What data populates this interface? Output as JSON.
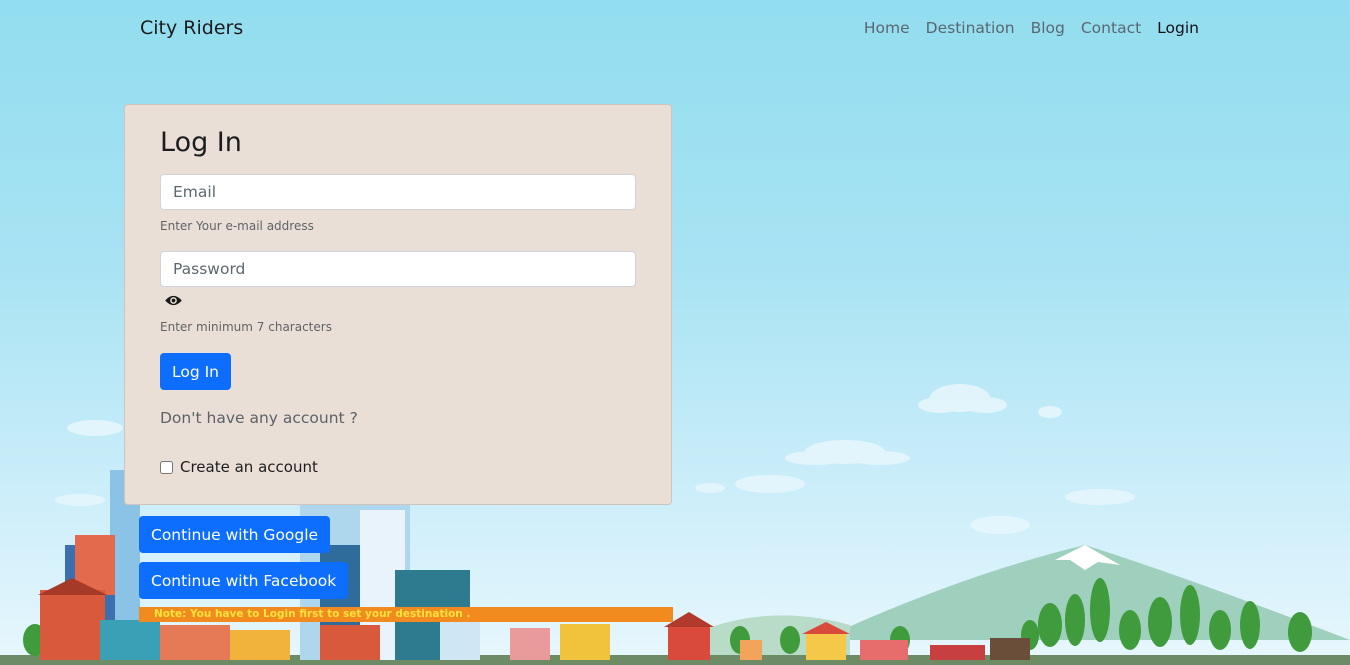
{
  "nav": {
    "brand": "City Riders",
    "links": [
      {
        "label": "Home"
      },
      {
        "label": "Destination"
      },
      {
        "label": "Blog"
      },
      {
        "label": "Contact"
      },
      {
        "label": "Login"
      }
    ]
  },
  "login_card": {
    "title": "Log In",
    "email_placeholder": "Email",
    "email_hint": "Enter Your e-mail address",
    "password_placeholder": "Password",
    "password_hint": "Enter minimum 7 characters",
    "submit_label": "Log In",
    "no_account_text": "Don't have any account ?",
    "create_account_label": "Create an account",
    "create_account_checked": false
  },
  "social": {
    "google_label": "Continue with Google",
    "facebook_label": "Continue with Facebook"
  },
  "note": "Note: You have to Login first to set your destination .",
  "colors": {
    "primary": "#0d6efd",
    "card_bg": "#e9dfd7",
    "note_bg": "#f28b1f",
    "note_text": "#ffe23c"
  },
  "icons": [
    "eye-icon"
  ]
}
